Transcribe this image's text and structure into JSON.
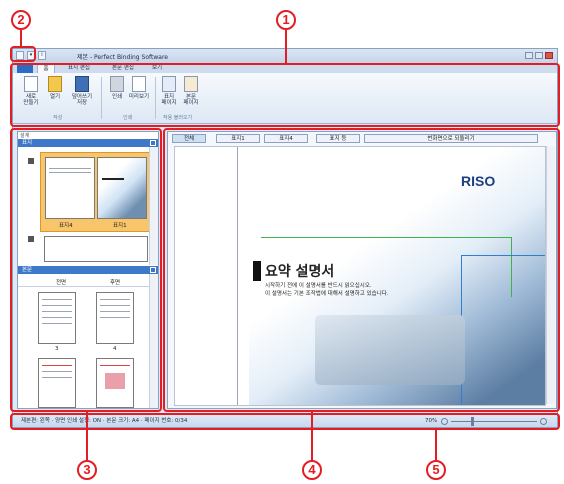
{
  "window": {
    "title": "제본 - Perfect Binding Software",
    "quick_access": [
      "▾",
      "i"
    ]
  },
  "ribbon": {
    "tabs": [
      "홈",
      "표지 편집",
      "본문 편집",
      "보기"
    ],
    "buttons": [
      {
        "label": "새로\n만들기",
        "icon": "new-document-icon"
      },
      {
        "label": "열기",
        "icon": "open-folder-icon"
      },
      {
        "label": "덮어쓰기\n저장",
        "icon": "save-disk-icon"
      },
      {
        "label": "인쇄",
        "icon": "printer-icon"
      },
      {
        "label": "미리보기",
        "icon": "preview-icon"
      },
      {
        "label": "표지\n페이지",
        "icon": "cover-page-icon"
      },
      {
        "label": "본문\n페이지",
        "icon": "body-page-icon"
      }
    ],
    "groups": [
      "작성",
      "인쇄",
      "작용 불러오기"
    ]
  },
  "left_panel": {
    "header_label": "설계",
    "cover_title": "표지",
    "cover_labels": [
      "표지4",
      "표지1"
    ],
    "body_title": "본문",
    "body_columns": [
      "전면",
      "후면"
    ],
    "body_page_numbers": [
      "3",
      "4"
    ]
  },
  "preview": {
    "tabs": [
      "전체",
      "표지1",
      "표지4",
      "표지 등",
      "번화면으로 되돌리기"
    ],
    "logo_text": "RISO",
    "heading": "요약 설명서",
    "lines": [
      "시작하기 전에 이 설명서를 반드시 읽으십시오.",
      "이 설명서는 기본 조작법에 대해서 설명하고 있습니다."
    ]
  },
  "status_bar": {
    "left_text": "제본편: 왼쪽 · 양면 인쇄 설정: ON · 본문 크기: A4 · 페이지 번호: 0/34",
    "zoom": "70%"
  },
  "callouts": [
    "1",
    "2",
    "3",
    "4",
    "5"
  ],
  "colors": {
    "callout": "#e41d24",
    "panel_header": "#3d78c9",
    "selection": "#f9c56a"
  }
}
